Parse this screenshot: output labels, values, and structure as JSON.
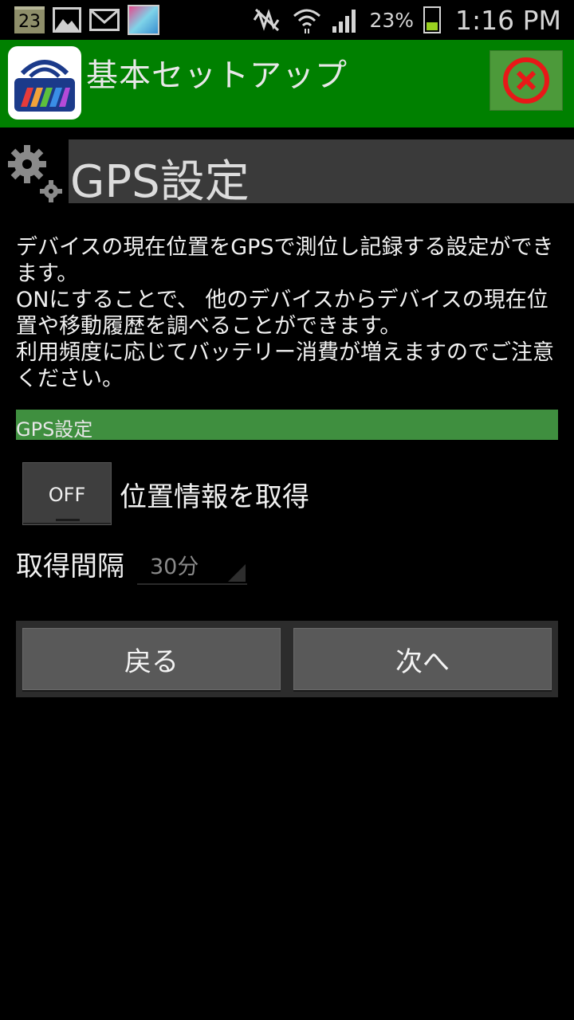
{
  "status_bar": {
    "calendar_day": "23",
    "battery_percent": "23%",
    "time": "1:16 PM",
    "icons": [
      "calendar-icon",
      "image-icon",
      "mail-icon",
      "app-thumbnail-icon",
      "mute-icon",
      "wifi-icon",
      "signal-icon",
      "battery-charging-icon"
    ]
  },
  "app_bar": {
    "title": "基本セットアップ",
    "close_icon": "close-icon",
    "accent_color": "#008000"
  },
  "section": {
    "title": "GPS設定",
    "icon": "gear-icon"
  },
  "description": {
    "lines": [
      "デバイスの現在位置をGPSで測位し記録する設定ができます。",
      "ONにすることで、 他のデバイスからデバイスの現在位置や移動履歴を調べることができます。",
      "利用頻度に応じてバッテリー消費が増えますのでご注意ください。"
    ]
  },
  "group": {
    "label": "GPS設定",
    "color": "#3f8f3f"
  },
  "gps_toggle": {
    "state": "OFF",
    "label": "位置情報を取得"
  },
  "interval": {
    "label": "取得間隔",
    "selected": "30分"
  },
  "buttons": {
    "back": "戻る",
    "next": "次へ"
  }
}
